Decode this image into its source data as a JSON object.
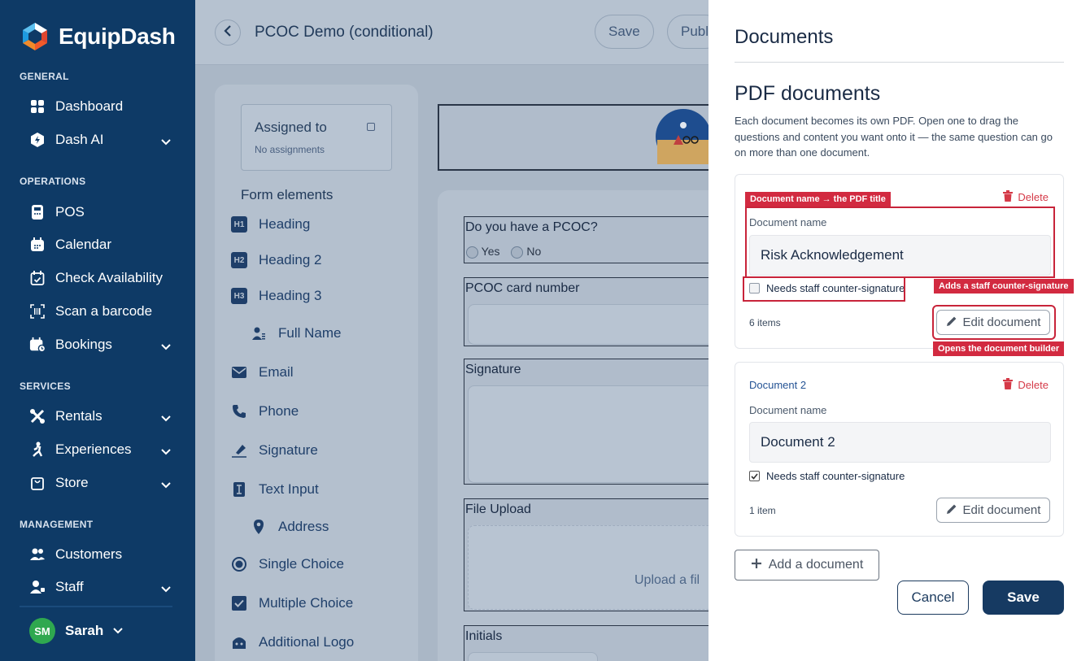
{
  "brand": {
    "name": "EquipDash"
  },
  "sidebar": {
    "sections": {
      "general": "GENERAL",
      "operations": "OPERATIONS",
      "services": "SERVICES",
      "management": "MANAGEMENT"
    },
    "items": [
      {
        "label": "Dashboard",
        "icon": "grid-icon"
      },
      {
        "label": "Dash AI",
        "icon": "ai-badge-icon"
      },
      {
        "label": "POS",
        "icon": "pos-terminal-icon"
      },
      {
        "label": "Calendar",
        "icon": "calendar-icon"
      },
      {
        "label": "Check Availability",
        "icon": "calendar-check-icon"
      },
      {
        "label": "Scan a barcode",
        "icon": "barcode-scan-icon"
      },
      {
        "label": "Bookings",
        "icon": "bookings-icon"
      },
      {
        "label": "Rentals",
        "icon": "rentals-icon"
      },
      {
        "label": "Experiences",
        "icon": "experiences-icon"
      },
      {
        "label": "Store",
        "icon": "store-bag-icon"
      },
      {
        "label": "Customers",
        "icon": "customers-icon"
      },
      {
        "label": "Staff",
        "icon": "staff-icon"
      }
    ],
    "user": {
      "initials": "SM",
      "name": "Sarah"
    }
  },
  "editor": {
    "title": "PCOC Demo (conditional)",
    "save_label": "Save",
    "publish_label": "Publ",
    "assigned": {
      "title": "Assigned to",
      "value": "No assignments"
    },
    "form_elements_title": "Form elements",
    "form_elements": [
      {
        "label": "Heading",
        "badge": "H1"
      },
      {
        "label": "Heading 2",
        "badge": "H2"
      },
      {
        "label": "Heading 3",
        "badge": "H3"
      },
      {
        "label": "Full Name"
      },
      {
        "label": "Email"
      },
      {
        "label": "Phone"
      },
      {
        "label": "Signature"
      },
      {
        "label": "Text Input"
      },
      {
        "label": "Address"
      },
      {
        "label": "Single Choice"
      },
      {
        "label": "Multiple Choice"
      },
      {
        "label": "Additional Logo"
      }
    ],
    "questions": {
      "pcoc": {
        "label": "Do you have a PCOC?",
        "yes": "Yes",
        "no": "No"
      },
      "card": "PCOC card number",
      "signature": "Signature",
      "file": "File Upload",
      "file_hint": "Upload a fil",
      "initials": "Initials"
    }
  },
  "documents_panel": {
    "title": "Documents",
    "section_title": "PDF documents",
    "description": "Each document becomes its own PDF. Open one to drag the questions and content you want onto it — the same question can go on more than one document.",
    "documents": [
      {
        "name_label": "Document name",
        "name_value": "Risk Acknowledgement",
        "countersign_label": "Needs staff counter-signature",
        "countersign_checked": false,
        "items_count": "6 items",
        "edit_label": "Edit document",
        "delete_label": "Delete"
      },
      {
        "heading": "Document 2",
        "name_label": "Document name",
        "name_value": "Document 2",
        "countersign_label": "Needs staff counter-signature",
        "countersign_checked": true,
        "items_count": "1 item",
        "edit_label": "Edit document",
        "delete_label": "Delete"
      }
    ],
    "add_label": "Add a document",
    "cancel_label": "Cancel",
    "save_label": "Save"
  },
  "annotations": {
    "doc_name": "Document name → the PDF title",
    "countersign": "Adds a staff counter-signature",
    "edit": "Opens the document builder"
  },
  "colors": {
    "sidebar": "#0e3a66",
    "accent_red": "#d22a40",
    "primary_button": "#163a62"
  }
}
